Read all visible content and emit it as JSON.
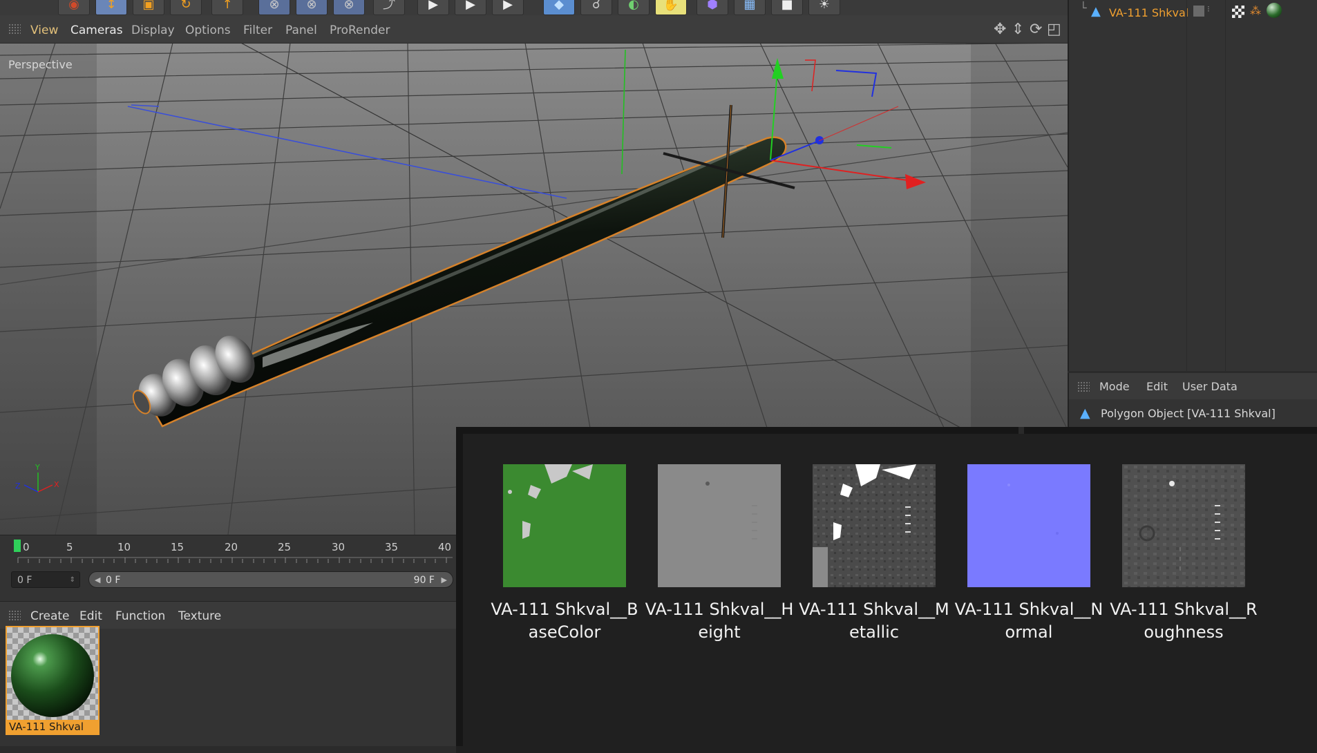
{
  "viewport": {
    "menu": [
      "View",
      "Cameras",
      "Display",
      "Options",
      "Filter",
      "Panel",
      "ProRender"
    ],
    "active_menu": "Cameras",
    "label": "Perspective"
  },
  "timeline": {
    "ticks": [
      "0",
      "5",
      "10",
      "15",
      "20",
      "25",
      "30",
      "35",
      "40"
    ],
    "current_frame": "0 F",
    "range_start": "0 F",
    "range_end": "90 F"
  },
  "material_manager": {
    "menu": [
      "Create",
      "Edit",
      "Function",
      "Texture"
    ],
    "material_name": "VA-111 Shkval"
  },
  "object_manager": {
    "object_name": "VA-111 Shkval"
  },
  "attributes": {
    "menu": [
      "Mode",
      "Edit",
      "User Data"
    ],
    "object_label": "Polygon Object [VA-111 Shkval]"
  },
  "file_browser": {
    "items": [
      {
        "name": "VA-111 Shkval__BaseColor"
      },
      {
        "name": "VA-111 Shkval__Height"
      },
      {
        "name": "VA-111 Shkval__Metallic"
      },
      {
        "name": "VA-111 Shkval__Normal"
      },
      {
        "name": "VA-111 Shkval__Roughness"
      }
    ]
  },
  "colors": {
    "accent": "#f0a030",
    "basecolor_green": "#3b8a30",
    "normal_blue": "#7a7aff"
  }
}
